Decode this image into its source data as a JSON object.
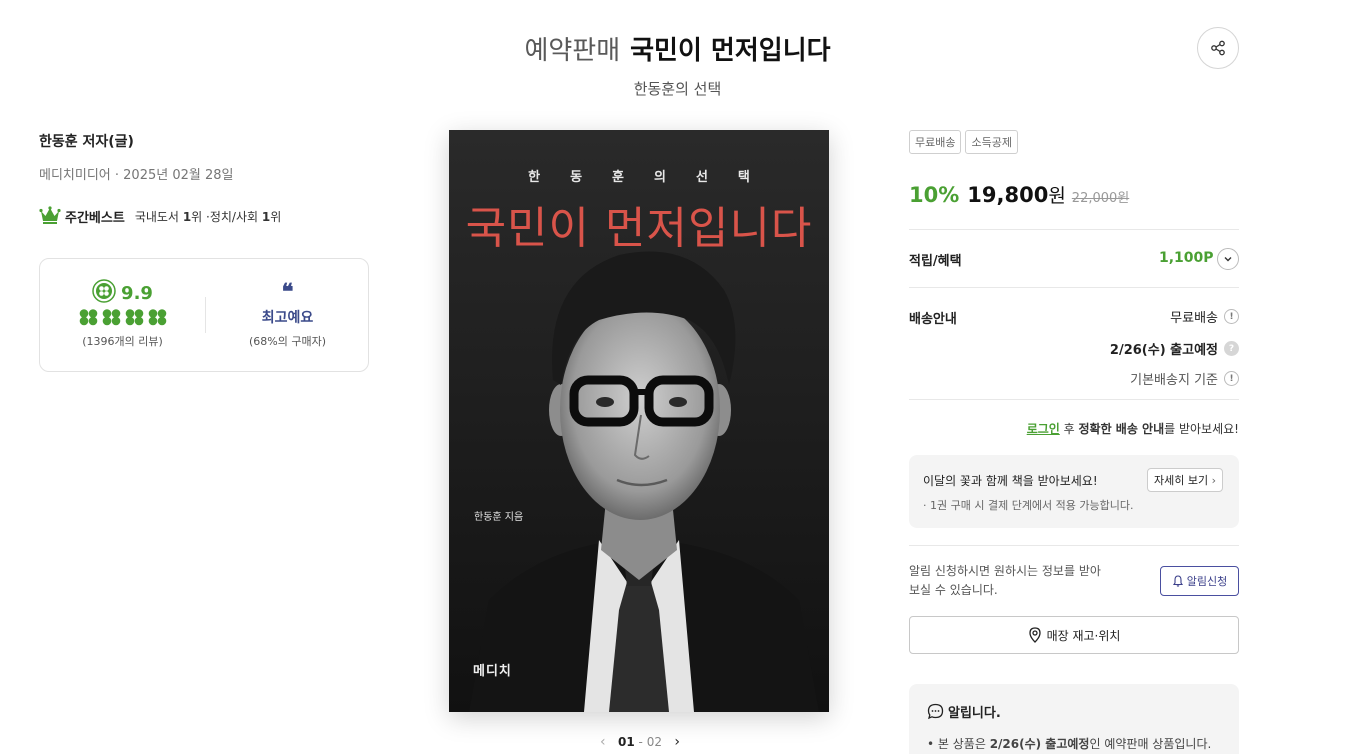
{
  "header": {
    "pre_label": "예약판매",
    "title": "국민이 먼저입니다",
    "subtitle": "한동훈의 선택",
    "share_icon": "share-icon"
  },
  "info": {
    "author": "한동훈 저자(글)",
    "publisher_date": "메디치미디어 · 2025년 02월 28일",
    "weekly_best": {
      "label": "주간베스트",
      "cat1": "국내도서",
      "rank1": "1",
      "rank_suffix1": "위 · ",
      "cat2": "정치/사회",
      "rank2": "1",
      "rank_suffix2": "위"
    }
  },
  "rating": {
    "score": "9.9",
    "review_count_num": "1396",
    "review_count_text": "개의 리뷰",
    "quote_icon": "quote-icon",
    "best_label": "최고예요",
    "buyer_pct_num": "68%",
    "buyer_pct_text": "의 구매자",
    "clover_fill": 4,
    "clover_color": "#4aa033"
  },
  "cover": {
    "subtitle": "한동훈의선택",
    "title": "국민이 먼저입니다",
    "author_line": "한동훈 지음",
    "logo": "메디치"
  },
  "pager": {
    "current": "01",
    "separator": " - ",
    "total": "02"
  },
  "purchase": {
    "tags": [
      "무료배송",
      "소득공제"
    ],
    "discount": "10%",
    "price": "19,800",
    "currency": "원",
    "original_price": "22,000원",
    "benefit_label": "적립/혜택",
    "points": "1,100P",
    "shipping_label": "배송안내",
    "shipping_free": "무료배송",
    "ship_date": "2/26(수) 출고예정",
    "ship_base": "기본배송지 기준",
    "login_link": "로그인",
    "login_after": " 후 ",
    "login_bold": "정확한 배송 안내",
    "login_tail": "를 받아보세요!",
    "promo_title": "이달의 꽃과 함께 책을 받아보세요!",
    "promo_note": "· 1권 구매 시 결제 단계에서 적용 가능합니다.",
    "promo_more": "자세히 보기",
    "alarm_text": "알림 신청하시면 원하시는 정보를 받아 보실 수 있습니다.",
    "alarm_button": "알림신청",
    "store_button": "매장 재고·위치",
    "notice_title": "알립니다.",
    "notice_pre": "• 본 상품은 ",
    "notice_bold": "2/26(수) 출고예정",
    "notice_post": "인 예약판매 상품입니다."
  },
  "colors": {
    "accent_green": "#4aa033",
    "navy": "#3b4a8a",
    "cover_title_red": "#d9544a"
  }
}
